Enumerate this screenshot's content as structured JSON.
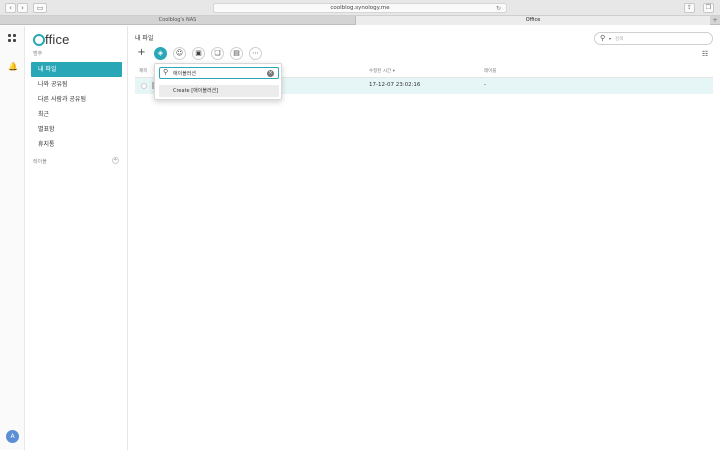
{
  "browser": {
    "url": "coolblog.synology.me",
    "tabs": [
      {
        "label": "Coolblog's NAS"
      },
      {
        "label": "Office"
      }
    ]
  },
  "app": {
    "logo_text": "ffice",
    "section_label": "범주",
    "nav": [
      {
        "label": "내 파일",
        "active": true
      },
      {
        "label": "나와 공유됨"
      },
      {
        "label": "다른 사람과 공유됨"
      },
      {
        "label": "최근"
      },
      {
        "label": "별표함"
      },
      {
        "label": "휴지통"
      }
    ],
    "labels_section": "레이블",
    "avatar_initial": "A"
  },
  "main": {
    "title": "내 파일",
    "search_placeholder": "검색",
    "table": {
      "columns": [
        "제목",
        "수정된 시간",
        "레이블"
      ],
      "sort_indicator": "▾",
      "rows": [
        {
          "modified": "17-12-07 23:02:16",
          "label": "-"
        }
      ]
    }
  },
  "label_popup": {
    "input_value": "애이블러션",
    "suggestion": "Create [애이블러션]"
  },
  "colors": {
    "accent": "#2aa7b7",
    "row_highlight": "#e6f6f7"
  }
}
